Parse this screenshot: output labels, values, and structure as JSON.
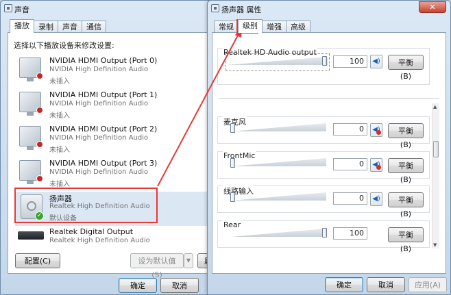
{
  "sound_window": {
    "title": "声音",
    "tabs": [
      "播放",
      "录制",
      "声音",
      "通信"
    ],
    "instruction": "选择以下播放设备来修改设置:",
    "devices": [
      {
        "name": "NVIDIA HDMI Output (Port 0)",
        "driver": "NVIDIA High Definition Audio",
        "status": "未插入"
      },
      {
        "name": "NVIDIA HDMI Output (Port 1)",
        "driver": "NVIDIA High Definition Audio",
        "status": "未插入"
      },
      {
        "name": "NVIDIA HDMI Output (Port 2)",
        "driver": "NVIDIA High Definition Audio",
        "status": "未插入"
      },
      {
        "name": "NVIDIA HDMI Output (Port 3)",
        "driver": "NVIDIA High Definition Audio",
        "status": "未插入"
      },
      {
        "name": "扬声器",
        "driver": "Realtek High Definition Audio",
        "status": "默认设备"
      },
      {
        "name": "Realtek Digital Output",
        "driver": "Realtek High Definition Audio",
        "status": ""
      }
    ],
    "buttons": {
      "configure": "配置(C)",
      "set_default": "设为默认值(S)",
      "properties_partial": "属",
      "ok": "确定",
      "cancel": "取消"
    }
  },
  "properties_window": {
    "title": "扬声器 属性",
    "tabs": [
      "常规",
      "级别",
      "增强",
      "高级"
    ],
    "active_tab": "级别",
    "levels": [
      {
        "name": "Realtek HD Audio output",
        "value": "100",
        "level": 1.0,
        "muted": false
      },
      {
        "name": "麦克风",
        "value": "0",
        "level": 0.0,
        "muted": true
      },
      {
        "name": "FrontMic",
        "value": "0",
        "level": 0.0,
        "muted": true
      },
      {
        "name": "线路输入",
        "value": "0",
        "level": 0.0,
        "muted": false
      },
      {
        "name": "Rear",
        "value": "100",
        "level": 1.0,
        "muted": false
      }
    ],
    "balance_label": "平衡(B)",
    "buttons": {
      "ok": "确定",
      "cancel": "取消",
      "apply": "应用(A)"
    },
    "close_label": "✕"
  },
  "colors": {
    "highlight_border": "#e53935",
    "arrow": "#e53935",
    "selected_row": "#dbe7f3"
  }
}
